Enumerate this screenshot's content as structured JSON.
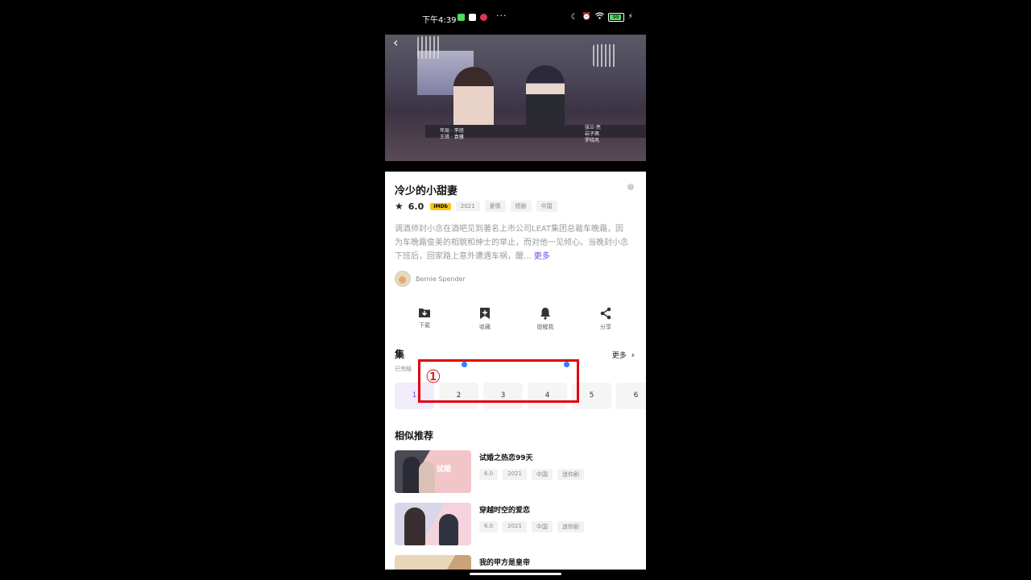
{
  "status_bar": {
    "time": "下午4:39",
    "battery": "99"
  },
  "video": {
    "credits_left": [
      "年局 · 李旭",
      "王琪 · 袁骥"
    ],
    "credits_right": [
      "张兰·亮",
      "岩子茜",
      "罗晓风"
    ]
  },
  "show": {
    "title": "冷少的小甜妻",
    "rating": "6.0",
    "imdb_label": "IMDb",
    "tags": [
      "2021",
      "爱情",
      "短剧",
      "中国"
    ],
    "description": "调酒师封小念在酒吧见到著名上市公司LEAT集团总裁车晚霜，因为车晚霜俊美的相貌和绅士的举止，而对他一见倾心。当晚封小念下班后，回家路上意外遭遇车祸，醒...",
    "more_link": "更多",
    "author": "Bernie Spender"
  },
  "actions": [
    {
      "label": "下载",
      "icon": "download-icon"
    },
    {
      "label": "收藏",
      "icon": "bookmark-add-icon"
    },
    {
      "label": "提醒我",
      "icon": "bell-icon"
    },
    {
      "label": "分享",
      "icon": "share-icon"
    }
  ],
  "episodes": {
    "title": "集",
    "status": "已完结",
    "more": "更多",
    "items": [
      "1",
      "2",
      "3",
      "4",
      "5",
      "6"
    ]
  },
  "recommendations": {
    "title": "相似推荐",
    "items": [
      {
        "title": "试婚之热恋99天",
        "tags": [
          "6.0",
          "2021",
          "中国",
          "迷你剧"
        ]
      },
      {
        "title": "穿越时空的爱恋",
        "tags": [
          "6.0",
          "2021",
          "中国",
          "迷你剧"
        ]
      },
      {
        "title": "我的甲方是皇帝",
        "tags": []
      }
    ]
  },
  "annotation": {
    "label": "①",
    "color": "#e0000f"
  },
  "colors": {
    "accent": "#7b3fe4",
    "imdb": "#f5c518"
  }
}
